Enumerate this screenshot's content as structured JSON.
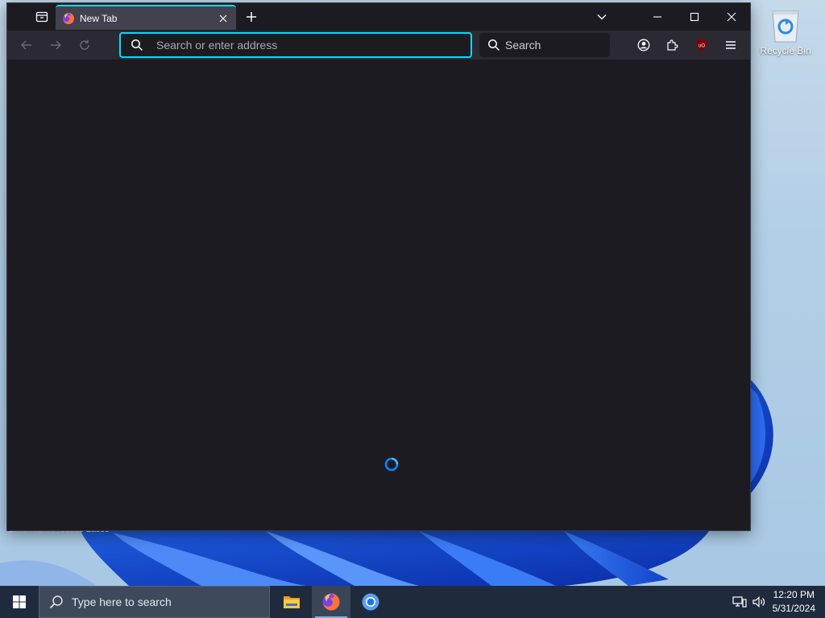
{
  "desktop": {
    "recycle_bin_label": "Recycle Bin",
    "background_text": "Chromium    Process Lasso"
  },
  "browser": {
    "tab": {
      "title": "New Tab",
      "favicon": "firefox-icon",
      "close": "close-icon"
    },
    "new_tab": "plus-icon",
    "window_controls": [
      "chevron-down-icon",
      "minimize-icon",
      "maximize-icon",
      "close-icon"
    ],
    "nav": {
      "back": "back-arrow-icon",
      "forward": "forward-arrow-icon",
      "reload": "reload-icon"
    },
    "urlbar": {
      "placeholder": "Search or enter address",
      "value": ""
    },
    "searchbox": {
      "label": "Search"
    },
    "toolbar_icons": [
      "account-icon",
      "extensions-icon",
      "ublock-icon",
      "menu-icon"
    ],
    "colors": {
      "accent": "#00ddff",
      "frame": "#1c1b22",
      "toolbar": "#2b2a33",
      "tab": "#42414d"
    }
  },
  "taskbar": {
    "search_placeholder": "Type here to search",
    "apps": [
      "file-explorer-icon",
      "firefox-icon",
      "chromium-icon"
    ],
    "active_app": "firefox-icon",
    "clock": {
      "time": "12:20 PM",
      "date": "5/31/2024"
    },
    "tray_icons": [
      "network-icon",
      "volume-icon"
    ]
  }
}
